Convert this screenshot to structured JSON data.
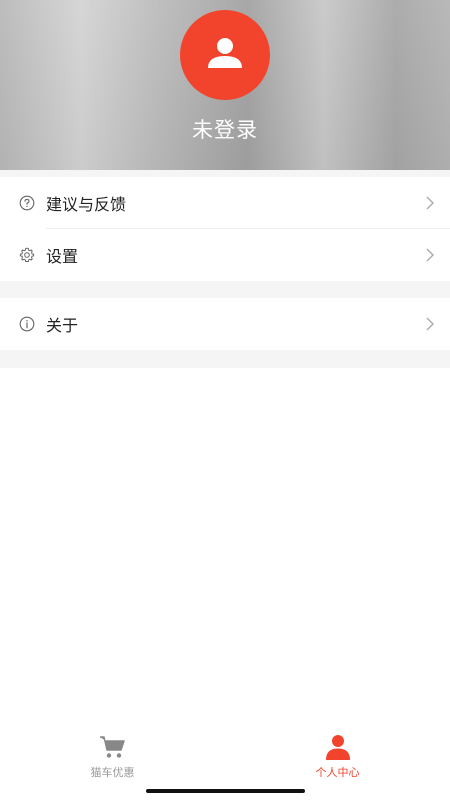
{
  "profile": {
    "login_status": "未登录",
    "avatar_color": "#f2442c"
  },
  "menu": {
    "group1": [
      {
        "label": "建议与反馈",
        "icon": "question-circle-icon"
      },
      {
        "label": "设置",
        "icon": "gear-icon"
      }
    ],
    "group2": [
      {
        "label": "关于",
        "icon": "info-circle-icon"
      }
    ]
  },
  "tabbar": {
    "tabs": [
      {
        "label": "猫车优惠",
        "icon": "cart-icon",
        "active": false
      },
      {
        "label": "个人中心",
        "icon": "user-icon",
        "active": true
      }
    ],
    "active_color": "#f2442c",
    "inactive_color": "#9a9a9a"
  }
}
